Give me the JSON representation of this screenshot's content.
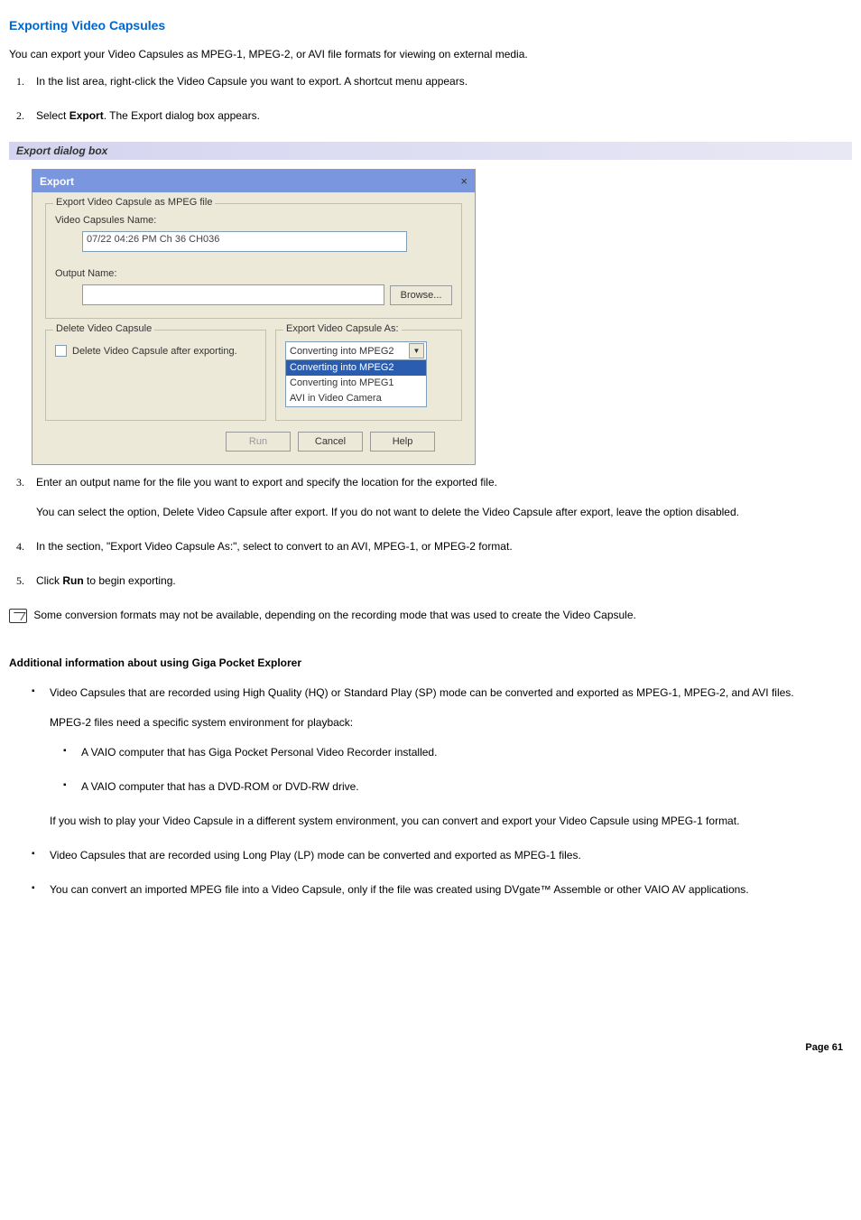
{
  "heading": "Exporting Video Capsules",
  "intro": "You can export your Video Capsules as MPEG-1, MPEG-2, or AVI file formats for viewing on external media.",
  "steps_first": [
    {
      "text": "In the list area, right-click the Video Capsule you want to export. A shortcut menu appears."
    },
    {
      "prefix": "Select ",
      "bold": "Export",
      "suffix": ". The Export dialog box appears."
    }
  ],
  "caption": "Export dialog box",
  "dialog": {
    "title": "Export",
    "close": "×",
    "group1_legend": "Export Video Capsule as MPEG file",
    "label_name": "Video Capsules Name:",
    "name_value": "07/22 04:26 PM Ch 36 CH036",
    "label_output": "Output Name:",
    "output_value": "",
    "browse": "Browse...",
    "group_delete_legend": "Delete Video Capsule",
    "delete_check_label": "Delete Video Capsule after exporting.",
    "group_export_as_legend": "Export Video Capsule As:",
    "combo_selected": "Converting into MPEG2",
    "combo_opts": [
      {
        "label": "Converting into MPEG2",
        "highlight": true
      },
      {
        "label": "Converting into MPEG1",
        "highlight": false
      },
      {
        "label": "AVI in Video Camera",
        "highlight": false
      }
    ],
    "btn_run": "Run",
    "btn_cancel": "Cancel",
    "btn_help": "Help"
  },
  "steps_rest": [
    {
      "main": "Enter an output name for the file you want to export and specify the location for the exported file.",
      "sub": "You can select the option, Delete Video Capsule after export. If you do not want to delete the Video Capsule after export, leave the option disabled."
    },
    {
      "main": "In the section, \"Export Video Capsule As:\", select to convert to an AVI, MPEG-1, or MPEG-2 format."
    },
    {
      "prefix": "Click ",
      "bold": "Run",
      "suffix": " to begin exporting."
    }
  ],
  "note": " Some conversion formats may not be available, depending on the recording mode that was used to create the Video Capsule.",
  "subheading": "Additional information about using Giga Pocket Explorer",
  "bullets": [
    {
      "main": "Video Capsules that are recorded using High Quality (HQ) or Standard Play (SP) mode can be converted and exported as MPEG-1, MPEG-2, and AVI files.",
      "sub1": "MPEG-2 files need a specific system environment for playback:",
      "inner": [
        "A VAIO computer that has Giga Pocket Personal Video Recorder installed.",
        "A VAIO computer that has a DVD-ROM or DVD-RW drive."
      ],
      "sub2": "If you wish to play your Video Capsule in a different system environment, you can convert and export your Video Capsule using MPEG-1 format."
    },
    {
      "main": "Video Capsules that are recorded using Long Play (LP) mode can be converted and exported as MPEG-1 files."
    },
    {
      "main": "You can convert an imported MPEG file into a Video Capsule, only if the file was created using DVgate™ Assemble or other VAIO AV applications."
    }
  ],
  "page_number": "Page 61"
}
